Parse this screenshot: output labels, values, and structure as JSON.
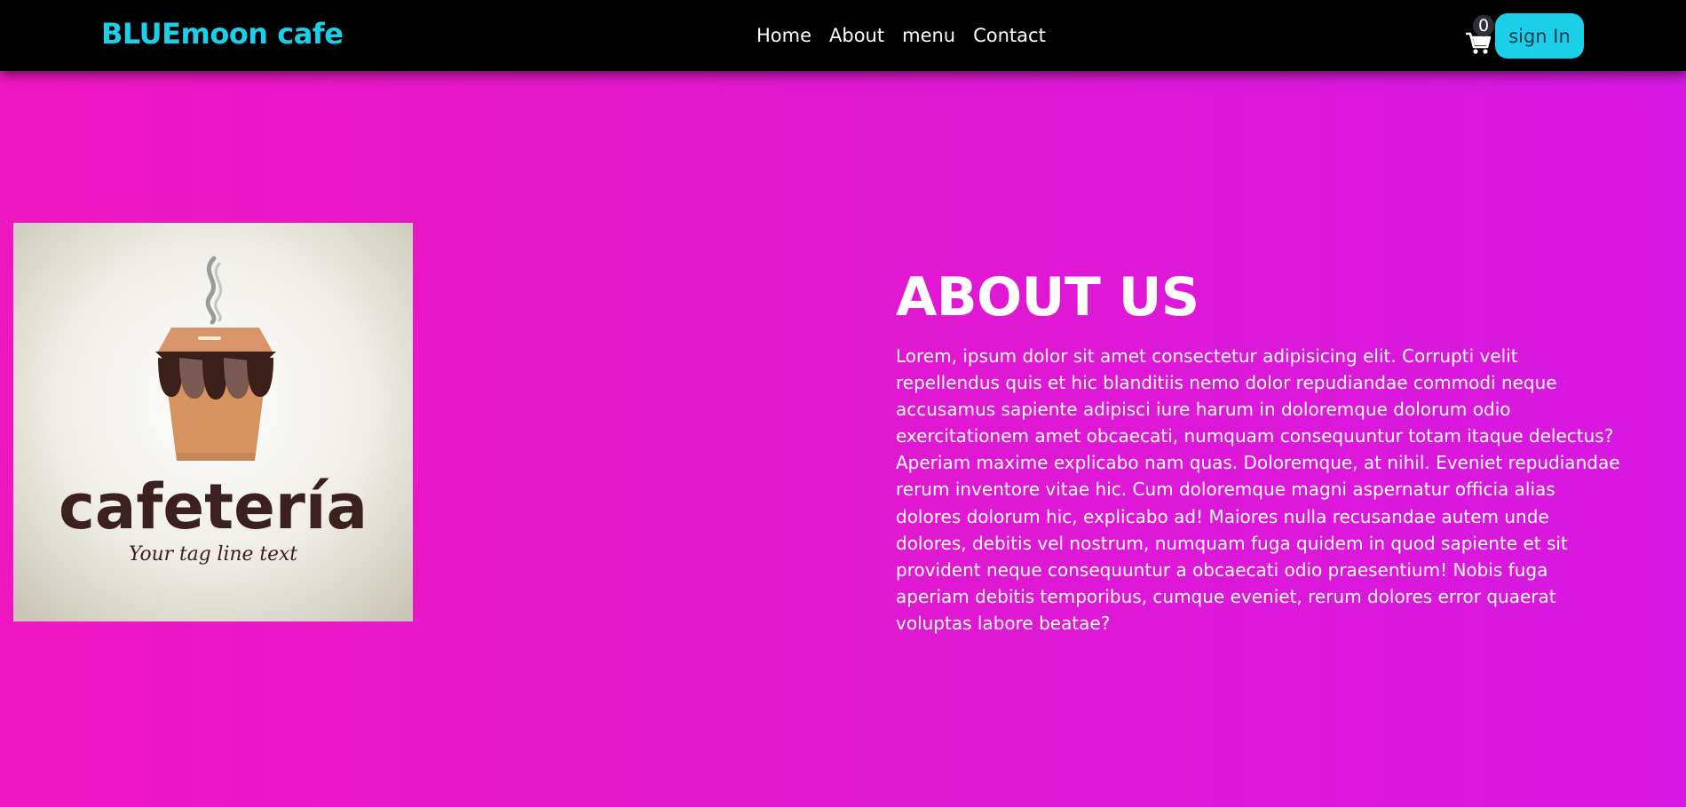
{
  "navbar": {
    "brand": "BLUEmoon cafe",
    "links": [
      "Home",
      "About",
      "menu",
      "Contact"
    ],
    "cart_count": "0",
    "signin_label": "sign In"
  },
  "about": {
    "title": "ABOUT US",
    "body": "Lorem, ipsum dolor sit amet consectetur adipisicing elit. Corrupti velit repellendus quis et hic blanditiis nemo dolor repudiandae commodi neque accusamus sapiente adipisci iure harum in doloremque dolorum odio exercitationem amet obcaecati, numquam consequuntur totam itaque delectus? Aperiam maxime explicabo nam quas. Doloremque, at nihil. Eveniet repudiandae rerum inventore vitae hic. Cum doloremque magni aspernatur officia alias dolores dolorum hic, explicabo ad! Maiores nulla recusandae autem unde dolores, debitis vel nostrum, numquam fuga quidem in quod sapiente et sit provident neque consequuntur a obcaecati odio praesentium! Nobis fuga aperiam debitis temporibus, cumque eveniet, rerum dolores error quaerat voluptas labore beatae?"
  },
  "logo": {
    "name": "cafetería",
    "tagline": "Your tag line text"
  },
  "icons": {
    "cart": "shopping-cart-icon"
  },
  "colors": {
    "accent": "#1ccfe9",
    "navbar_bg": "#000000",
    "page_gradient_start": "#ef17c1",
    "page_gradient_end": "#d718e2"
  }
}
